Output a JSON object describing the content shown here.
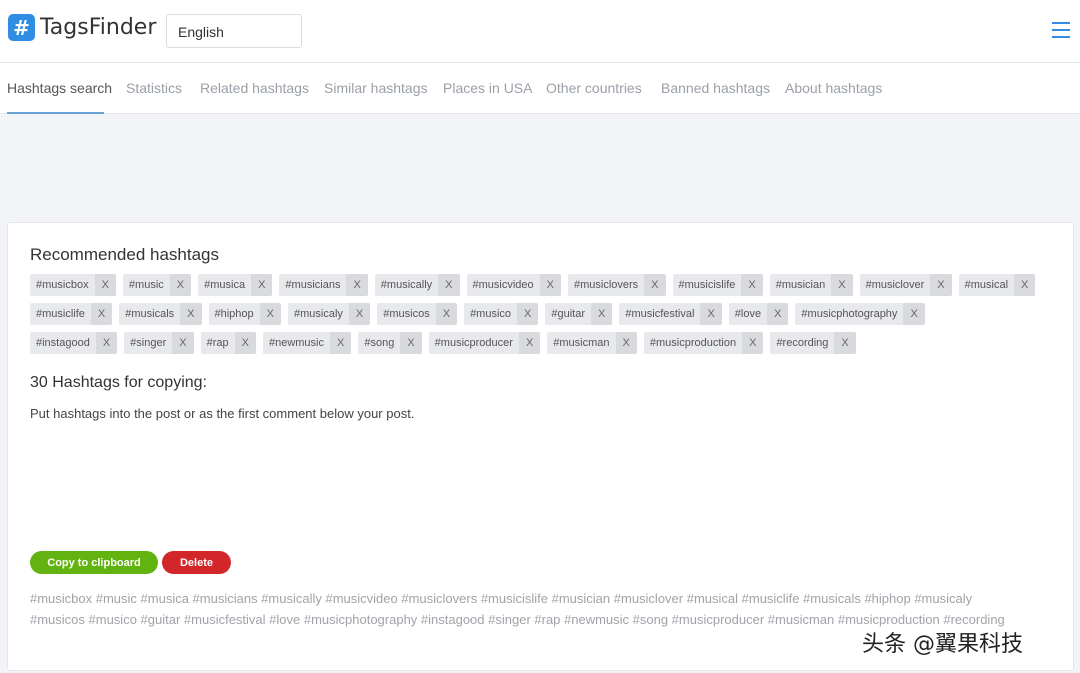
{
  "header": {
    "logo_symbol": "#",
    "logo_text": "TagsFinder",
    "language": "English",
    "brand_color": "#2f8de4"
  },
  "nav": {
    "tabs": [
      {
        "label": "Hashtags search",
        "active": true
      },
      {
        "label": "Statistics"
      },
      {
        "label": "Related hashtags"
      },
      {
        "label": "Similar hashtags"
      },
      {
        "label": "Places in USA"
      },
      {
        "label": "Other countries"
      },
      {
        "label": "Banned hashtags"
      },
      {
        "label": "About hashtags"
      }
    ]
  },
  "main": {
    "recommended_title": "Recommended hashtags",
    "remove_label": "X",
    "tag_rows": [
      [
        "#musicbox",
        "#music",
        "#musica",
        "#musicians",
        "#musically",
        "#musicvideo",
        "#musiclovers",
        "#musicislife",
        "#musician",
        "#musiclover",
        "#musical"
      ],
      [
        "#musiclife",
        "#musicals",
        "#hiphop",
        "#musicaly",
        "#musicos",
        "#musico",
        "#guitar",
        "#musicfestival",
        "#love",
        "#musicphotography"
      ],
      [
        "#instagood",
        "#singer",
        "#rap",
        "#newmusic",
        "#song",
        "#musicproducer",
        "#musicman",
        "#musicproduction",
        "#recording"
      ]
    ],
    "copy_title": "30 Hashtags for copying:",
    "instruction": "Put hashtags into the post or as the first comment below your post.",
    "copy_button": "Copy to clipboard",
    "delete_button": "Delete",
    "output_text": "#musicbox #music #musica #musicians #musically #musicvideo #musiclovers #musicislife #musician #musiclover #musical #musiclife #musicals #hiphop #musicaly #musicos #musico #guitar #musicfestival #love #musicphotography #instagood #singer #rap #newmusic #song #musicproducer #musicman #musicproduction #recording",
    "copy_color": "#62b30f",
    "delete_color": "#d3262a"
  },
  "watermark": "头条 @翼果科技"
}
